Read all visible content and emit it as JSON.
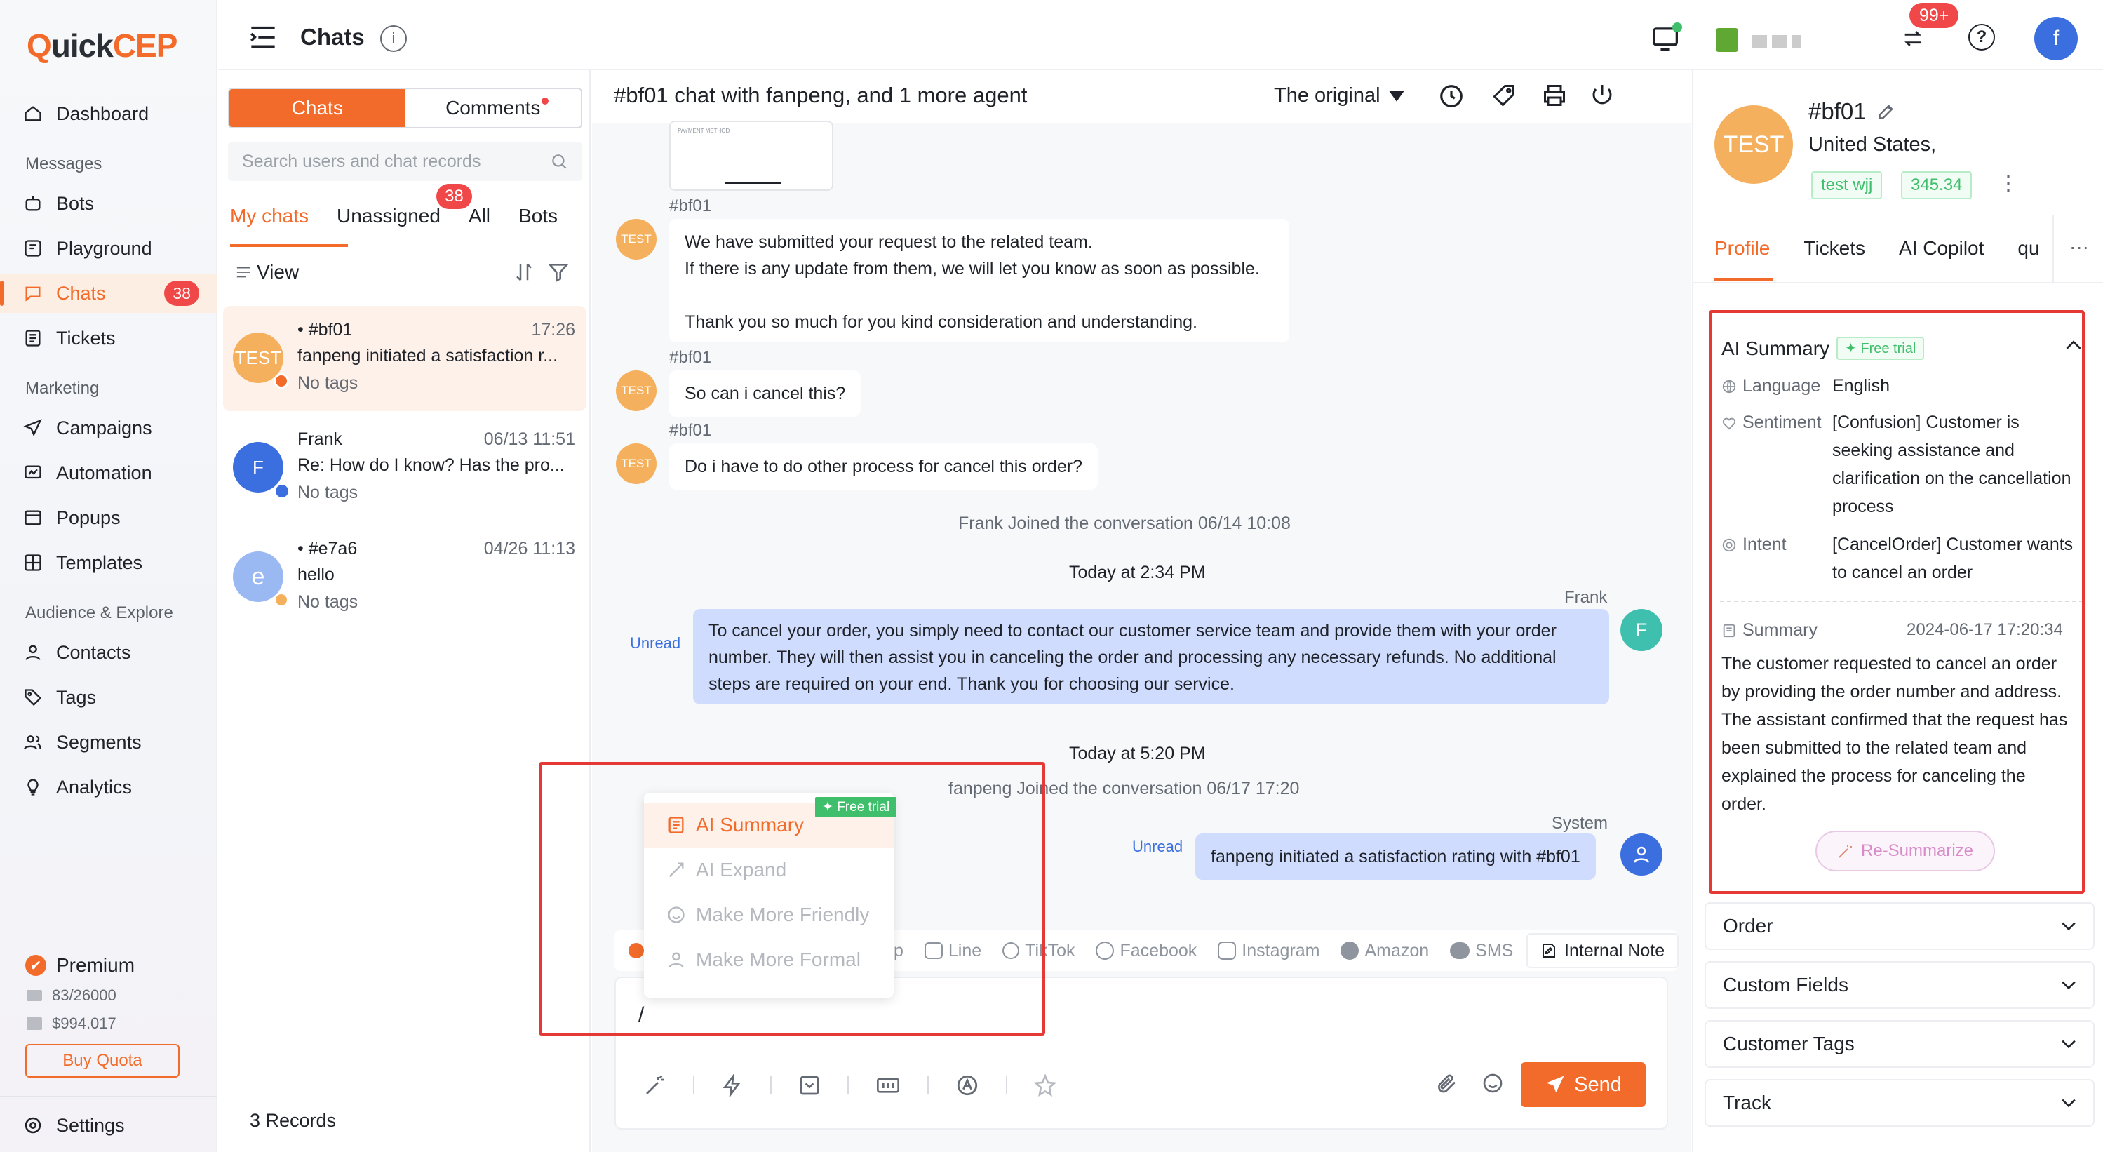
{
  "app": {
    "logo_q": "Q",
    "logo_uick": "uick",
    "logo_cep": "CEP"
  },
  "sidebar": {
    "dashboard": "Dashboard",
    "messages_section": "Messages",
    "bots": "Bots",
    "playground": "Playground",
    "chats": "Chats",
    "chats_badge": "38",
    "tickets": "Tickets",
    "marketing_section": "Marketing",
    "campaigns": "Campaigns",
    "automation": "Automation",
    "popups": "Popups",
    "templates": "Templates",
    "audience_section": "Audience & Explore",
    "contacts": "Contacts",
    "tags": "Tags",
    "segments": "Segments",
    "analytics": "Analytics",
    "plan": "Premium",
    "quota_count": "83/26000",
    "quota_money": "$994.017",
    "buy_quota": "Buy Quota",
    "settings": "Settings"
  },
  "topbar": {
    "title": "Chats",
    "notif_badge": "99+"
  },
  "chatlist": {
    "seg_chats": "Chats",
    "seg_comments": "Comments",
    "search_placeholder": "Search users and chat records",
    "tab_my": "My chats",
    "tab_unassigned": "Unassigned",
    "unassigned_badge": "38",
    "tab_all": "All",
    "tab_bots": "Bots",
    "view": "View",
    "records": "3 Records",
    "items": [
      {
        "avatar": "TEST",
        "name": "#bf01",
        "time": "17:26",
        "preview": "fanpeng initiated a satisfaction r...",
        "tags": "No tags"
      },
      {
        "avatar": "F",
        "name": "Frank",
        "time": "06/13 11:51",
        "preview": "Re: How do I know? Has the pro...",
        "tags": "No tags"
      },
      {
        "avatar": "e",
        "name": "#e7a6",
        "time": "04/26 11:13",
        "preview": "hello",
        "tags": "No tags"
      }
    ]
  },
  "conversation": {
    "header": "#bf01 chat with fanpeng, and 1 more agent",
    "translation": "The original",
    "attach_thumb_text": "PAYMENT METHOD",
    "messages": [
      {
        "sender": "#bf01",
        "avatar": "TEST",
        "line1": "We have submitted your request to the related team.",
        "line2": "If there is any update from them, we will let you know as soon as possible.",
        "line3": "Thank you so much for you kind consideration and understanding."
      },
      {
        "sender": "#bf01",
        "avatar": "TEST",
        "text": "So can i cancel this?"
      },
      {
        "sender": "#bf01",
        "avatar": "TEST",
        "text": "Do i have to do other process for cancel this order?"
      }
    ],
    "joined_frank": "Frank Joined the conversation  06/14 10:08",
    "today_1": "Today at 2:34 PM",
    "agent_name": "Frank",
    "agent_avatar": "F",
    "unread": "Unread",
    "agent_msg_line1": "To cancel your order, you simply need to contact our customer service team and provide them with your order",
    "agent_msg_line2": "number. They will then assist you in canceling the order and processing any necessary refunds. No additional",
    "agent_msg_line3": "steps are required on your end. Thank you for choosing our service.",
    "today_2": "Today at 5:20 PM",
    "joined_fanpeng": "fanpeng Joined the conversation  06/17 17:20",
    "system_name": "System",
    "system_msg": "fanpeng initiated a satisfaction rating with #bf01",
    "channels": [
      "p",
      "Line",
      "TikTok",
      "Facebook",
      "Instagram",
      "Amazon",
      "SMS"
    ],
    "internal_note": "Internal Note",
    "editor_text": "/",
    "send": "Send",
    "popup": {
      "free_trial": "Free trial",
      "items": [
        "AI Summary",
        "AI Expand",
        "Make More Friendly",
        "Make More Formal"
      ]
    }
  },
  "profile": {
    "avatar": "TEST",
    "name": "#bf01",
    "country": "United States,",
    "tag1": "test wjj",
    "tag2": "345.34",
    "tabs": [
      "Profile",
      "Tickets",
      "AI Copilot",
      "qu"
    ],
    "more": "···",
    "ai_summary_title": "AI Summary",
    "free_trial": "Free trial",
    "language_label": "Language",
    "language_value": "English",
    "sentiment_label": "Sentiment",
    "sentiment_lines": [
      "[Confusion] Customer is",
      "seeking assistance and",
      "clarification on the cancellation",
      "process"
    ],
    "intent_label": "Intent",
    "intent_lines": [
      "[CancelOrder] Customer wants",
      "to cancel an order"
    ],
    "summary_label": "Summary",
    "summary_time": "2024-06-17 17:20:34",
    "summary_lines": [
      "The customer requested to cancel an order",
      "by providing the order number and address.",
      "The assistant confirmed that the request has",
      "been submitted to the related team and",
      "explained the process for canceling the",
      "order."
    ],
    "resummarize": "Re-Summarize",
    "sections": [
      "Order",
      "Custom Fields",
      "Customer Tags",
      "Track"
    ]
  },
  "colors": {
    "accent": "#f26b2a",
    "agent_bubble": "#cfdcfd",
    "highlight_box": "#e53935"
  }
}
